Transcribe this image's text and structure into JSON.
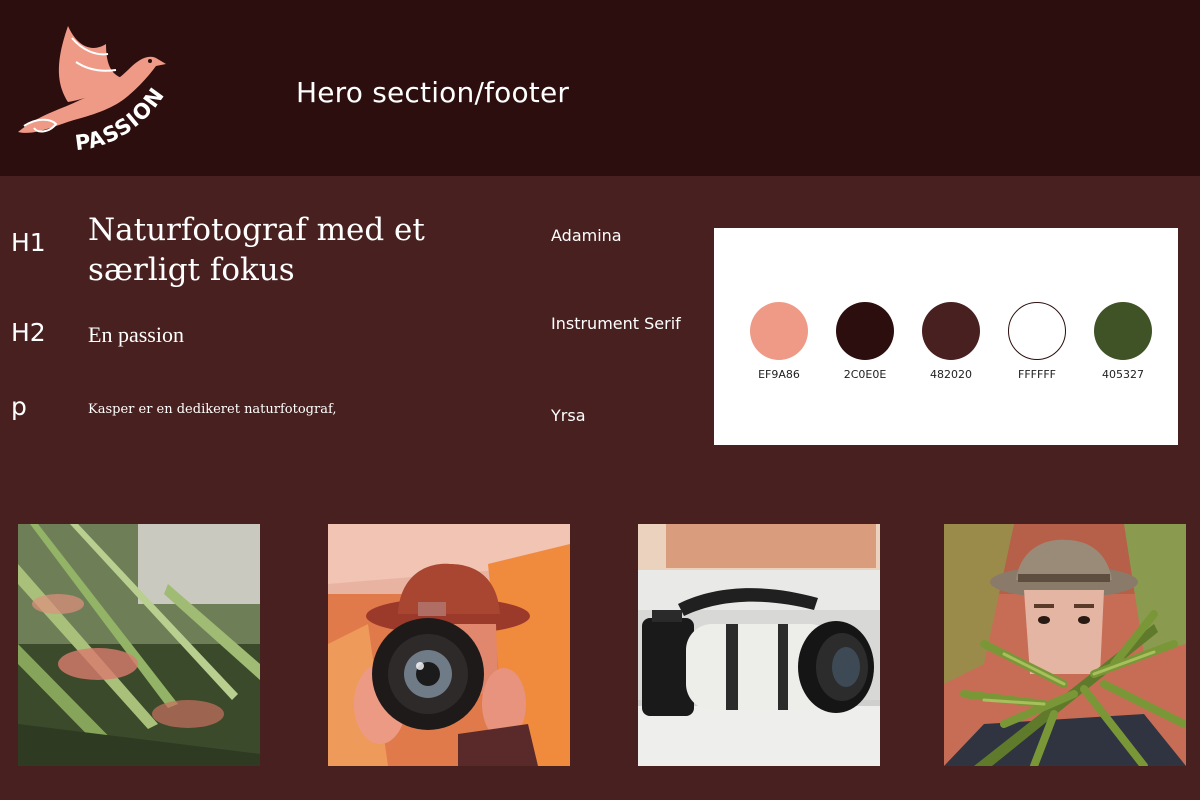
{
  "header": {
    "title": "Hero section/footer",
    "logo_text": "PASSION"
  },
  "typography": {
    "h1": {
      "tag": "H1",
      "sample": "Naturfotograf med et særligt fokus",
      "font": "Adamina"
    },
    "h2": {
      "tag": "H2",
      "sample": "En passion",
      "font": "Instrument Serif"
    },
    "p": {
      "tag": "p",
      "sample": "Kasper er en dedikeret naturfotograf,",
      "font": "Yrsa"
    }
  },
  "palette": {
    "colors": [
      {
        "hex": "EF9A86",
        "value": "#EF9A86"
      },
      {
        "hex": "2C0E0E",
        "value": "#2C0E0E"
      },
      {
        "hex": "482020",
        "value": "#482020"
      },
      {
        "hex": "FFFFFF",
        "value": "#FFFFFF"
      },
      {
        "hex": "405327",
        "value": "#405327"
      }
    ]
  },
  "photos": [
    {
      "subject": "palm-leaves"
    },
    {
      "subject": "photographer-with-camera"
    },
    {
      "subject": "camera-with-telephoto-lens"
    },
    {
      "subject": "man-behind-palm-leaf"
    }
  ]
}
